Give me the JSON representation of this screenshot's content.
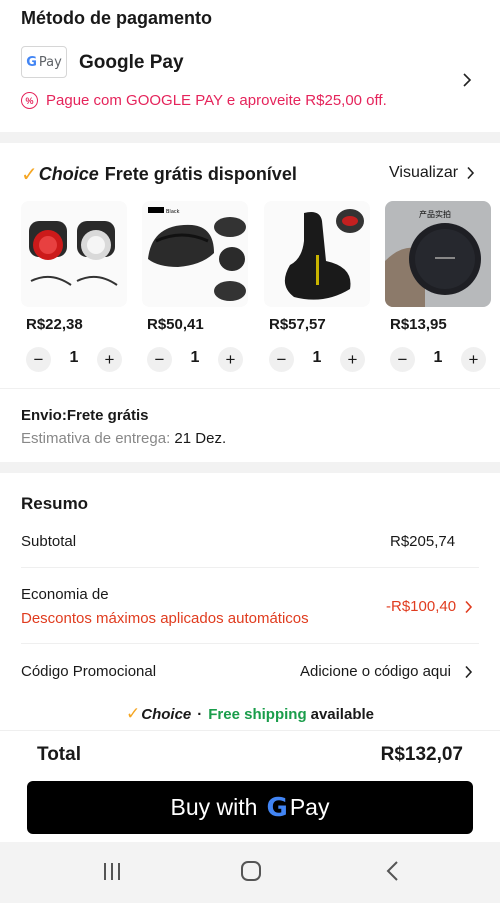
{
  "payment": {
    "title": "Método de pagamento",
    "badge_label": "Pay",
    "badge_g": "G",
    "method_name": "Google Pay",
    "promo_text": "Pague com GOOGLE PAY e aproveite R$25,00 off.",
    "promo_icon": "%",
    "accent_color": "#e5245b"
  },
  "choice": {
    "brand": "Choice",
    "free_text": "Frete grátis disponível",
    "view_label": "Visualizar",
    "products": [
      {
        "price": "R$22,38",
        "qty": "1",
        "image": "bike-lights"
      },
      {
        "price": "R$50,41",
        "qty": "1",
        "image": "bike-helmet",
        "tag": "Black"
      },
      {
        "price": "R$57,57",
        "qty": "1",
        "image": "bike-saddle"
      },
      {
        "price": "R$13,95",
        "qty": "1",
        "image": "wireless-charger",
        "tag": "产品实拍"
      }
    ],
    "minus": "−",
    "plus": "+"
  },
  "shipping": {
    "envio": "Envio:Frete grátis",
    "estimate_label": "Estimativa de entrega:",
    "estimate_value": "21 Dez."
  },
  "summary": {
    "title": "Resumo",
    "subtotal_label": "Subtotal",
    "subtotal_value": "R$205,74",
    "economia_label": "Economia de",
    "economia_detail": "Descontos máximos aplicados automáticos",
    "economia_value": "-R$100,40",
    "promo_label": "Código Promocional",
    "promo_action": "Adicione o código aqui",
    "discount_color": "#e03c1f"
  },
  "choice_bar": {
    "brand": "Choice",
    "dot": "·",
    "free": "Free shipping",
    "available": "available",
    "free_color": "#1a9d4b"
  },
  "total": {
    "label": "Total",
    "value": "R$132,07"
  },
  "buy_button": {
    "prefix": "Buy with",
    "g": "G",
    "suffix": "Pay"
  },
  "navbar": {
    "icons": [
      "recent-apps-icon",
      "home-icon",
      "back-icon"
    ]
  }
}
